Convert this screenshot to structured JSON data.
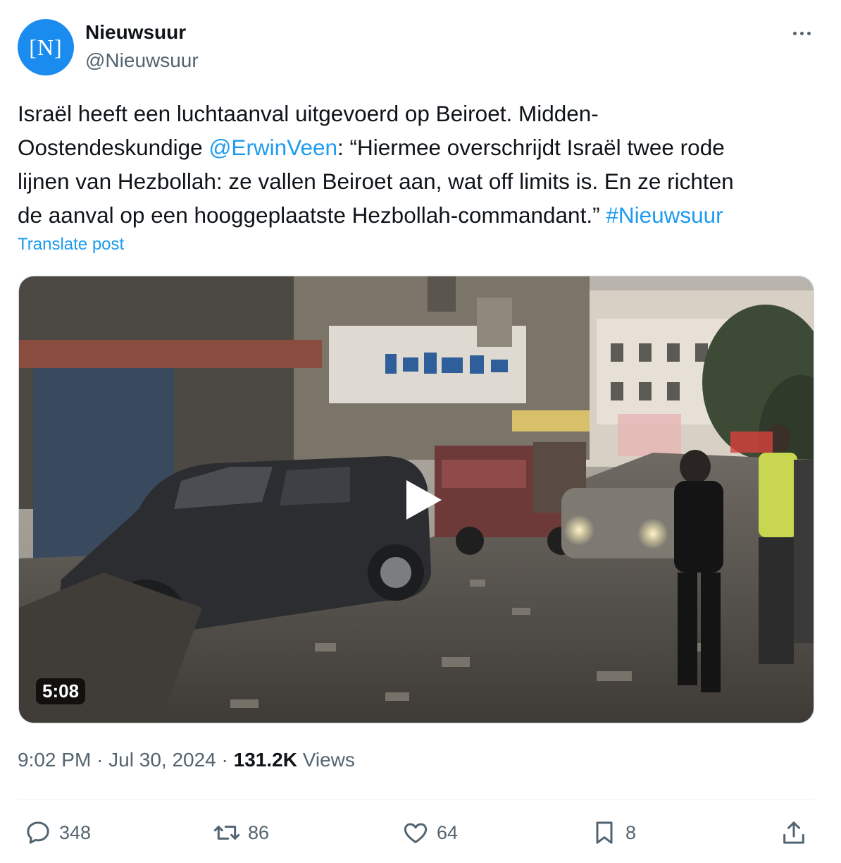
{
  "author": {
    "name": "Nieuwsuur",
    "handle": "@Nieuwsuur",
    "avatar_mark": "[N]"
  },
  "post": {
    "text_1": "Israël heeft een luchtaanval uitgevoerd op Beiroet. Midden-\nOostendeskundige ",
    "mention": "@ErwinVeen",
    "text_2": ": “Hiermee overschrijdt Israël twee rode\nlijnen van Hezbollah: ze vallen Beiroet aan, wat off limits is. En ze richten\nde aanval op een hooggeplaatste Hezbollah-commandant.” ",
    "hashtag": "#Nieuwsuur"
  },
  "translate_label": "Translate post",
  "video": {
    "duration": "5:08",
    "play_icon": "play-icon"
  },
  "meta": {
    "time": "9:02 PM",
    "separator": "·",
    "date": "Jul 30, 2024",
    "views_count": "131.2K",
    "views_label": "Views"
  },
  "actions": {
    "replies": "348",
    "reposts": "86",
    "likes": "64",
    "bookmarks": "8"
  },
  "colors": {
    "accent": "#1d9bf0",
    "avatar": "#1a8cf0",
    "secondary_text": "#536471"
  }
}
